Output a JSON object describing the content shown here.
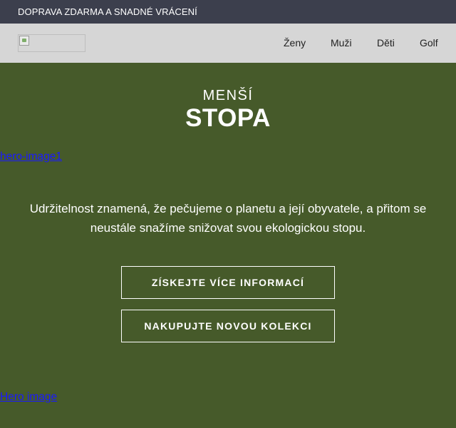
{
  "topbar": {
    "text": "DOPRAVA ZDARMA A SNADNÉ VRÁCENÍ"
  },
  "header": {
    "nav": [
      {
        "label": "Ženy"
      },
      {
        "label": "Muži"
      },
      {
        "label": "Děti"
      },
      {
        "label": "Golf"
      }
    ]
  },
  "hero": {
    "subtitle": "MENŠÍ",
    "title": "STOPA",
    "image1_alt": "hero-image1",
    "description": "Udržitelnost znamená, že pečujeme o planetu a její obyvatele, a přitom se neustále snažíme snižovat svou ekologickou stopu.",
    "buttons": [
      {
        "label": "ZÍSKEJTE VÍCE INFORMACÍ"
      },
      {
        "label": "NAKUPUJTE NOVOU KOLEKCI"
      }
    ],
    "image2_alt": "Hero image"
  },
  "colors": {
    "topbar_bg": "#3c3f4d",
    "header_bg": "#d6d6d6",
    "hero_bg": "#465a2a",
    "link": "#1a1aff"
  }
}
